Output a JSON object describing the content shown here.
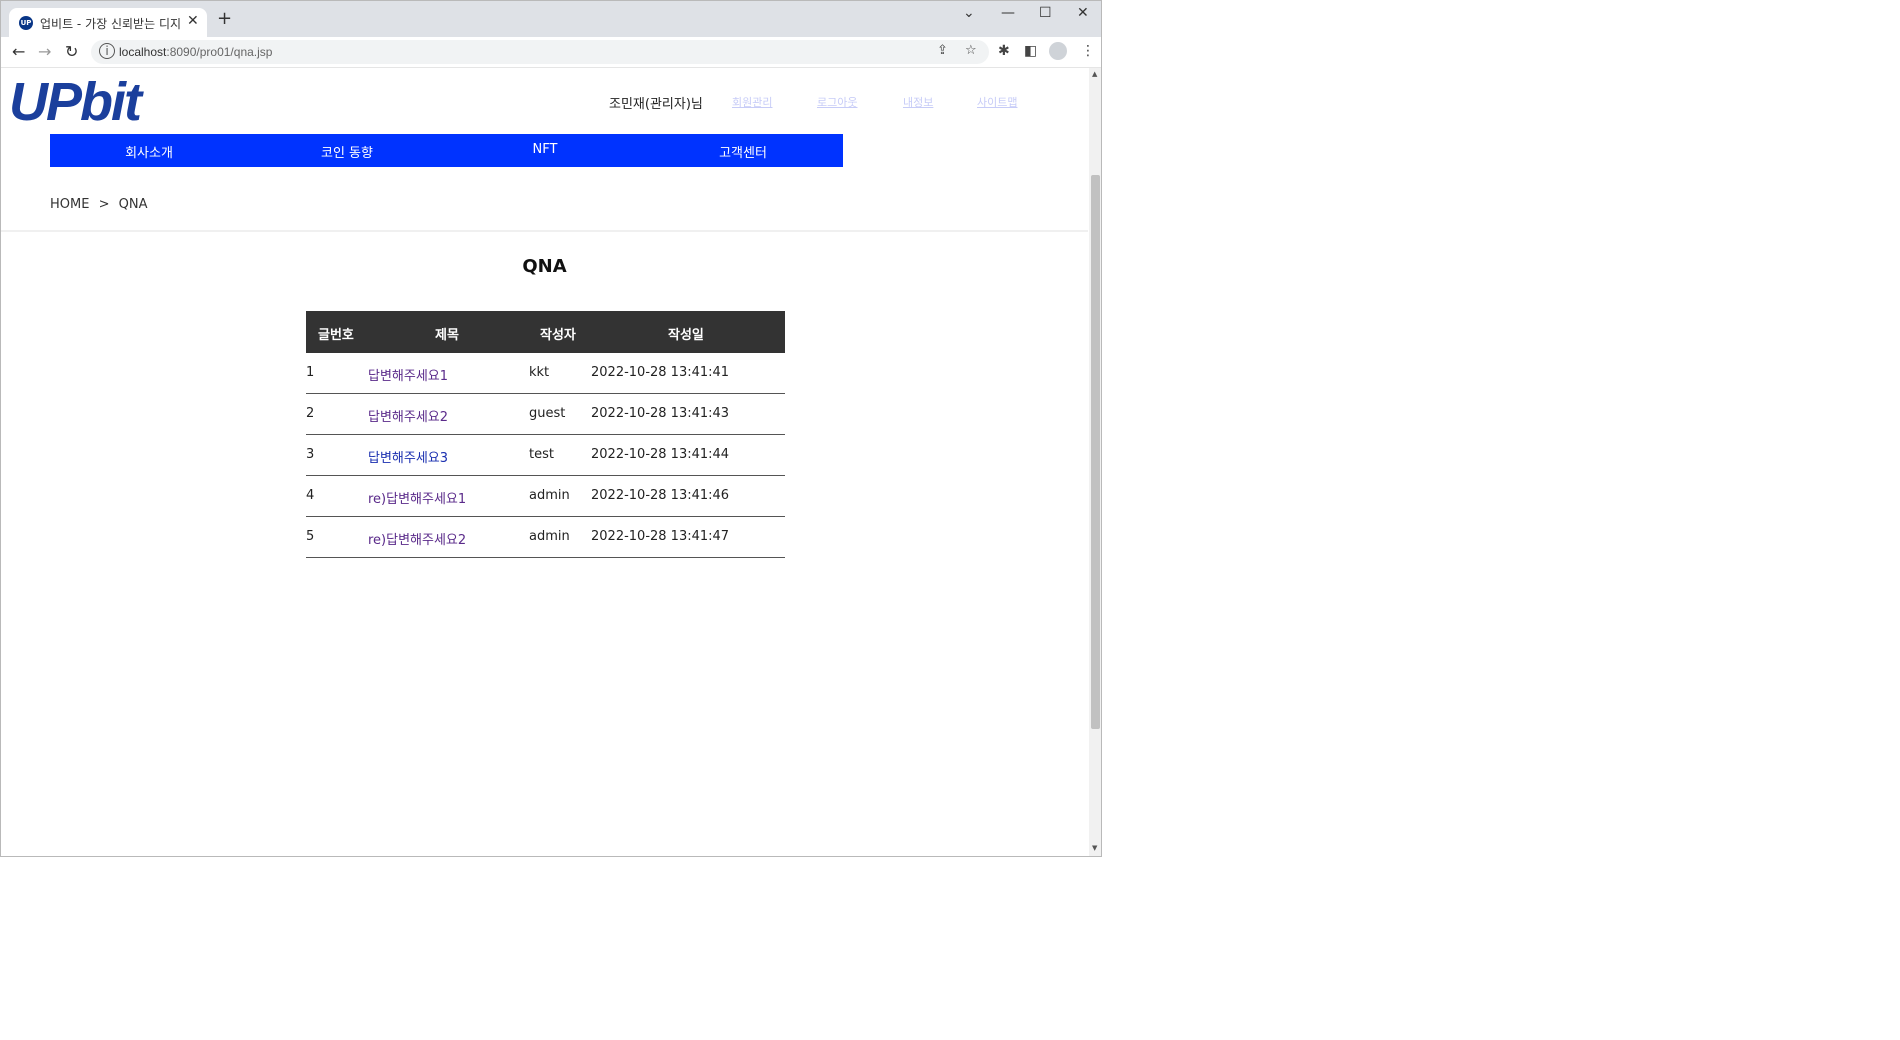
{
  "browser": {
    "tab_title": "업비트 - 가장 신뢰받는 디지털",
    "tab_favicon": "UP",
    "url_host": "localhost",
    "url_rest": ":8090/pro01/qna.jsp"
  },
  "header": {
    "logo": "UPbit",
    "user_greeting": "조민재(관리자)님",
    "links": [
      "회원관리",
      "로그아웃",
      "내정보",
      "사이트맵"
    ]
  },
  "gnb": {
    "items": [
      "회사소개",
      "코인 동향",
      "NFT",
      "고객센터"
    ],
    "color": "#0033ff"
  },
  "breadcrumb": {
    "home": "HOME",
    "separator": ">",
    "current": "QNA"
  },
  "page": {
    "title": "QNA"
  },
  "table": {
    "headers": [
      "글번호",
      "제목",
      "작성자",
      "작성일"
    ],
    "rows": [
      {
        "no": "1",
        "title": "답변해주세요1",
        "author": "kkt",
        "date": "2022-10-28 13:41:41"
      },
      {
        "no": "2",
        "title": "답변해주세요2",
        "author": "guest",
        "date": "2022-10-28 13:41:43"
      },
      {
        "no": "3",
        "title": "답변해주세요3",
        "author": "test",
        "date": "2022-10-28 13:41:44"
      },
      {
        "no": "4",
        "title": "re)답변해주세요1",
        "author": "admin",
        "date": "2022-10-28 13:41:46"
      },
      {
        "no": "5",
        "title": "re)답변해주세요2",
        "author": "admin",
        "date": "2022-10-28 13:41:47"
      }
    ]
  }
}
